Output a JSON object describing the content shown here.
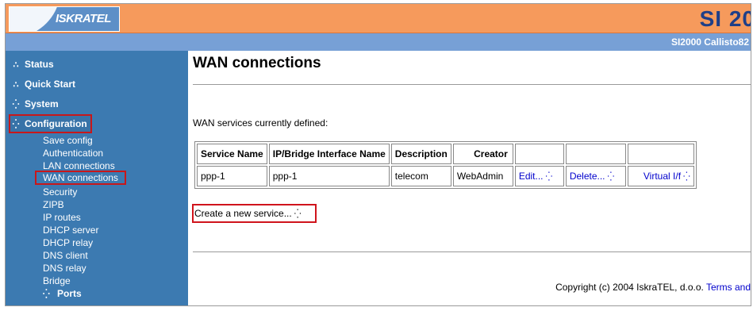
{
  "header": {
    "logo_text": "ISKRATEL",
    "brand": "SI 20",
    "model": "SI2000 Callisto82"
  },
  "sidebar": {
    "items": [
      {
        "label": "Status",
        "icon": "dots-collapsed-icon"
      },
      {
        "label": "Quick Start",
        "icon": "dots-collapsed-icon"
      },
      {
        "label": "System",
        "icon": "dots-expand-icon"
      },
      {
        "label": "Configuration",
        "icon": "dots-expand-icon"
      }
    ],
    "config_subitems": [
      "Save config",
      "Authentication",
      "LAN connections",
      "WAN connections",
      "Security",
      "ZIPB",
      "IP routes",
      "DHCP server",
      "DHCP relay",
      "DNS client",
      "DNS relay",
      "Bridge"
    ],
    "ports_label": "Ports"
  },
  "main": {
    "title": "WAN connections",
    "intro": "WAN services currently defined:",
    "table": {
      "headers": [
        "Service Name",
        "IP/Bridge Interface Name",
        "Description",
        "Creator",
        "",
        "",
        ""
      ],
      "rows": [
        {
          "service": "ppp-1",
          "interface": "ppp-1",
          "description": "telecom",
          "creator": "WebAdmin",
          "edit": "Edit...",
          "delete": "Delete...",
          "virtual": "Virtual I/f"
        }
      ]
    },
    "create_label": "Create a new service...",
    "footer_text": "Copyright (c) 2004 IskraTEL, d.o.o. ",
    "footer_link": "Terms and"
  },
  "glyphs": {
    "dots": "⁛"
  },
  "colors": {
    "header_orange": "#f69a5c",
    "subheader_blue": "#77a0d6",
    "sidebar_blue": "#3c7ab1",
    "highlight_red": "#c8171a",
    "link_blue": "#0000cc"
  }
}
